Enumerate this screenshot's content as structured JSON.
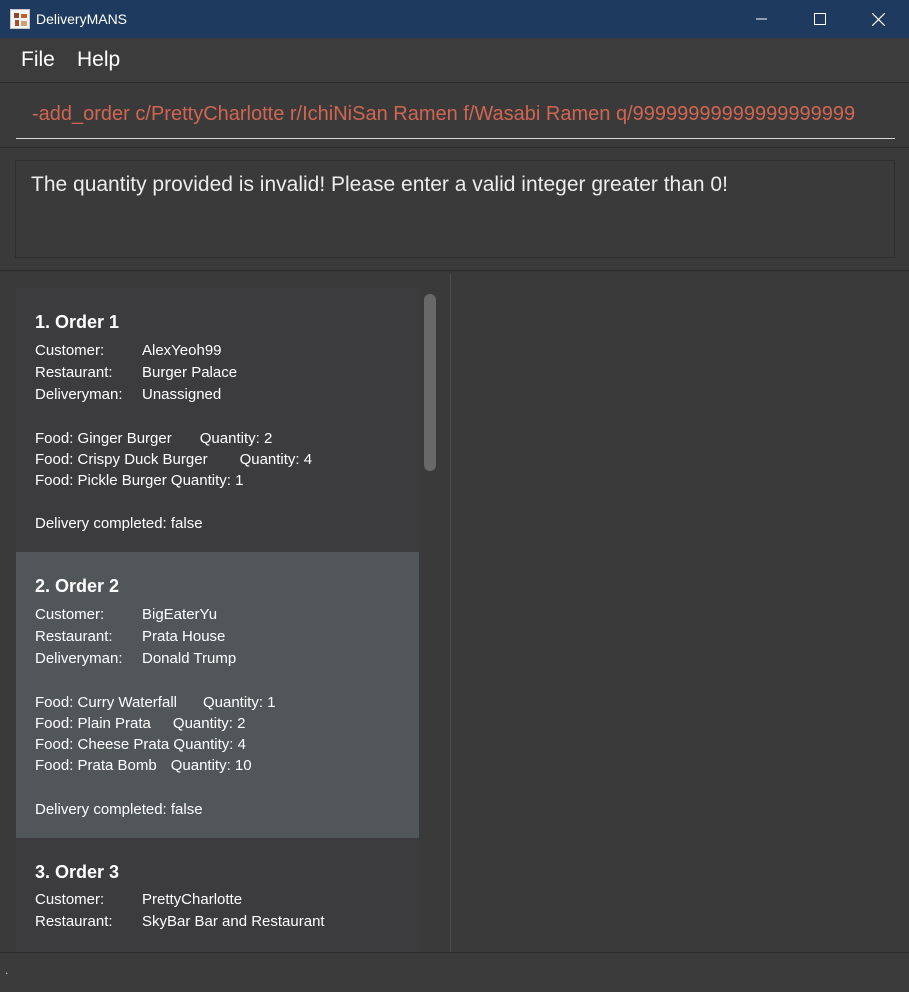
{
  "window": {
    "title": "DeliveryMANS"
  },
  "menu": {
    "file": "File",
    "help": "Help"
  },
  "command": {
    "text": "-add_order c/PrettyCharlotte r/IchiNiSan Ramen f/Wasabi Ramen q/99999999999999999999"
  },
  "result": {
    "text": "The quantity provided is invalid! Please enter a valid integer greater than 0!"
  },
  "labels": {
    "customer": "Customer:",
    "restaurant": "Restaurant:",
    "deliveryman": "Deliveryman:"
  },
  "orders": [
    {
      "title": "1.  Order 1",
      "customer": "AlexYeoh99",
      "restaurant": "Burger Palace",
      "deliveryman": "Unassigned",
      "foods": [
        {
          "food": "Food: Ginger Burger",
          "qty": "Quantity: 2"
        },
        {
          "food": "Food: Crispy Duck Burger",
          "qty": "Quantity: 4"
        },
        {
          "food": "Food: Pickle Burger",
          "qty": "Quantity: 1"
        }
      ],
      "delivery": "Delivery completed: false"
    },
    {
      "title": "2.  Order 2",
      "customer": "BigEaterYu",
      "restaurant": "Prata House",
      "deliveryman": "Donald Trump",
      "foods": [
        {
          "food": "Food: Curry Waterfall",
          "qty": "Quantity: 1"
        },
        {
          "food": "Food: Plain Prata",
          "qty": "Quantity: 2"
        },
        {
          "food": "Food: Cheese Prata",
          "qty": "Quantity: 4"
        },
        {
          "food": "Food: Prata Bomb",
          "qty": "Quantity: 10"
        }
      ],
      "delivery": "Delivery completed: false"
    },
    {
      "title": "3.  Order 3",
      "customer": "PrettyCharlotte",
      "restaurant": "SkyBar Bar and Restaurant"
    }
  ],
  "status": {
    "text": "."
  },
  "colors": {
    "titlebar": "#1e3a5f",
    "background": "#3a3a3a",
    "card": "#3c3c3e",
    "card_selected": "#515759",
    "command_text": "#d06651"
  },
  "icons": {
    "minimize": "minimize-icon",
    "maximize": "maximize-icon",
    "close": "close-icon",
    "app": "app-icon"
  }
}
